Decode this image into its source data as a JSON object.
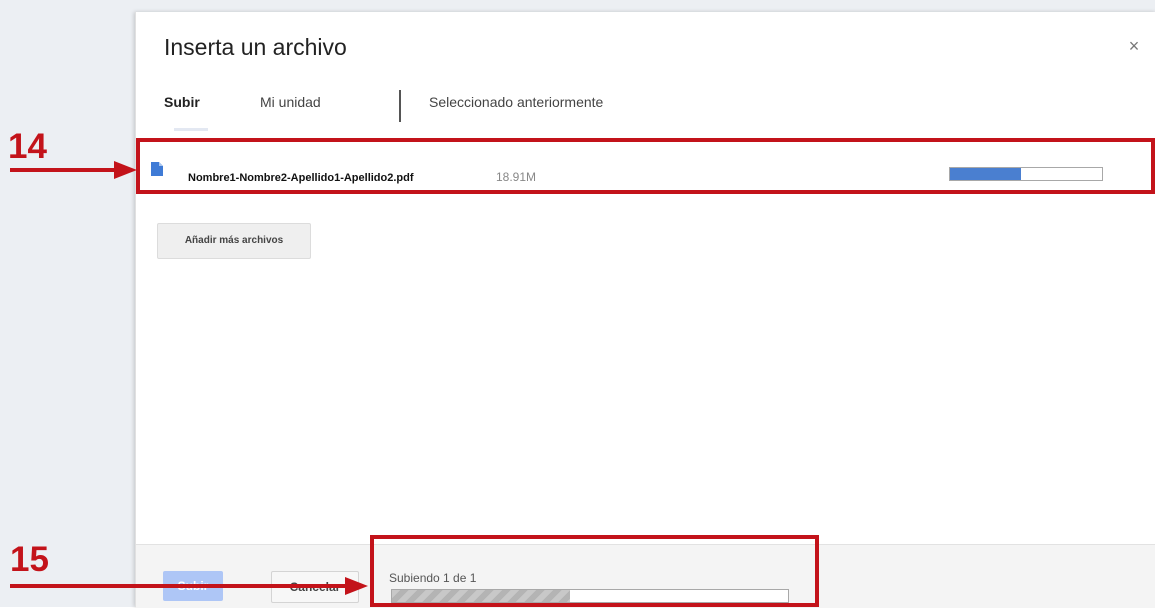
{
  "dialog": {
    "title": "Inserta un archivo",
    "close_glyph": "×"
  },
  "tabs": [
    {
      "label": "Subir",
      "active": true
    },
    {
      "label": "Mi unidad",
      "active": false
    },
    {
      "label": "Seleccionado anteriormente",
      "active": false
    }
  ],
  "file": {
    "icon": "document-icon",
    "name": "Nombre1-Nombre2-Apellido1-Apellido2.pdf",
    "size": "18.91M",
    "progress": 0.47
  },
  "add_more_label": "Añadir más archivos",
  "footer": {
    "upload_label": "Subir",
    "cancel_label": "Cancelar",
    "status": "Subiendo 1 de 1",
    "progress": 0.45
  },
  "annotations": [
    {
      "label": "14"
    },
    {
      "label": "15"
    }
  ],
  "colors": {
    "annotation": "#c3131a",
    "progress_fill": "#4a7fd0",
    "upload_button": "#aec6f6"
  }
}
